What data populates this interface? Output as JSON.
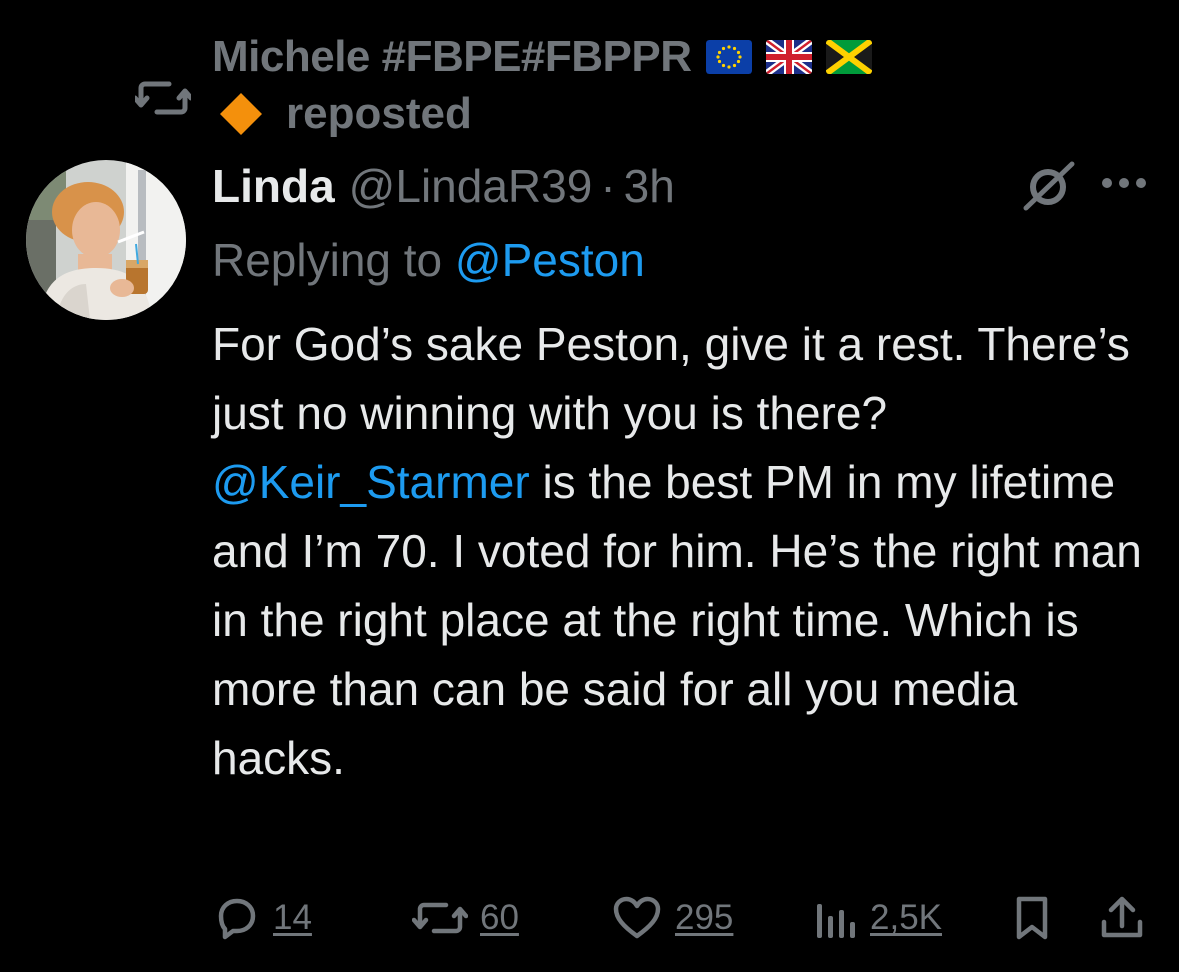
{
  "repost": {
    "reposter_name": "Michele #FBPE#FBPPR",
    "reposter_flags": [
      "eu-flag-icon",
      "uk-flag-icon",
      "jamaica-flag-icon"
    ],
    "badge_emoji": "orange-diamond-icon",
    "label": "reposted"
  },
  "tweet": {
    "author_name": "Linda",
    "author_handle": "@LindaR39",
    "separator": "·",
    "timestamp": "3h",
    "replying_label": "Replying to",
    "replying_mention": "@Peston",
    "text_before_mention": "For God’s sake Peston, give it a rest. There’s just no winning with you is there?  ",
    "text_mention": "@Keir_Starmer",
    "text_after_mention": " is the best PM in my lifetime and I’m 70. I voted for him. He’s the right man in the right place at the right time. Which is more than can be said for all you media hacks."
  },
  "actions": {
    "replies": "14",
    "reposts": "60",
    "likes": "295",
    "views": "2,5K"
  },
  "colors": {
    "background": "#000000",
    "primary_text": "#e7e9ea",
    "secondary_text": "#71767b",
    "link": "#1d9bf0",
    "diamond": "#f4900c"
  }
}
